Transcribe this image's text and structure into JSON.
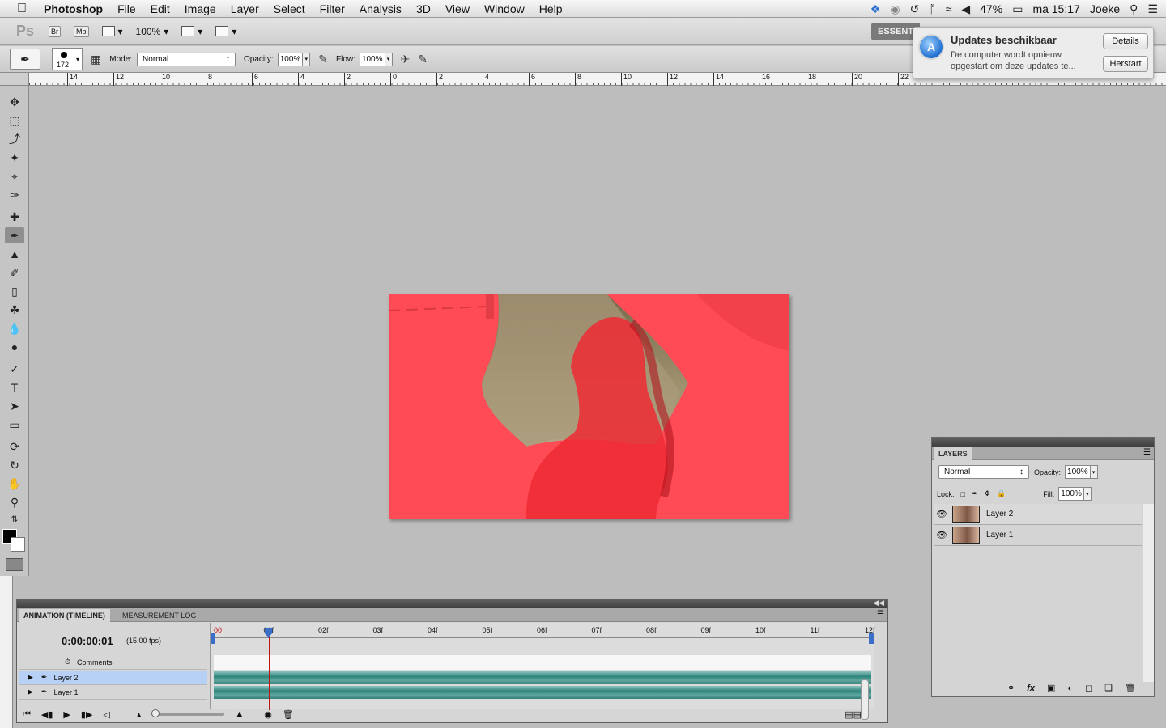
{
  "menubar": {
    "apple_icon": "apple-logo-icon",
    "app_name": "Photoshop",
    "items": [
      "File",
      "Edit",
      "Image",
      "Layer",
      "Select",
      "Filter",
      "Analysis",
      "3D",
      "View",
      "Window",
      "Help"
    ],
    "status": {
      "battery": "47%",
      "clock": "ma 15:17",
      "user": "Joeke"
    }
  },
  "appbar": {
    "logo": "Ps",
    "bridge": "Br",
    "minibridge": "Mb",
    "zoom": "100%",
    "workspace": "ESSENTIALS"
  },
  "options": {
    "brush_size": "172",
    "mode_label": "Mode:",
    "mode_value": "Normal",
    "opacity_label": "Opacity:",
    "opacity_value": "100%",
    "flow_label": "Flow:",
    "flow_value": "100%"
  },
  "ruler": {
    "labels": [
      "14",
      "12",
      "10",
      "8",
      "6",
      "4",
      "2",
      "0",
      "2",
      "4",
      "6",
      "8",
      "10",
      "12",
      "14",
      "16",
      "18",
      "20",
      "22"
    ]
  },
  "notification": {
    "title": "Updates beschikbaar",
    "body": "De computer wordt opnieuw opgestart om deze updates te...",
    "details_button": "Details",
    "restart_button": "Herstart"
  },
  "layers_panel": {
    "tab": "LAYERS",
    "blend_mode": "Normal",
    "opacity_label": "Opacity:",
    "opacity_value": "100%",
    "lock_label": "Lock:",
    "fill_label": "Fill:",
    "fill_value": "100%",
    "layers": [
      {
        "name": "Layer 2",
        "visible": true
      },
      {
        "name": "Layer 1",
        "visible": true
      }
    ]
  },
  "timeline": {
    "tabs": [
      "ANIMATION (TIMELINE)",
      "MEASUREMENT LOG"
    ],
    "timecode": "0:00:00:01",
    "fps": "(15,00 fps)",
    "comments_label": "Comments",
    "tracks": [
      "Layer 2",
      "Layer 1"
    ],
    "frame_labels": [
      "00",
      "01f",
      "02f",
      "03f",
      "04f",
      "05f",
      "06f",
      "07f",
      "08f",
      "09f",
      "10f",
      "11f",
      "12f"
    ],
    "current_frame": 1
  },
  "colors": {
    "canvas_red": "#ff4b55",
    "selected_row": "#b6d1f5",
    "track_teal": "#2f857c"
  }
}
